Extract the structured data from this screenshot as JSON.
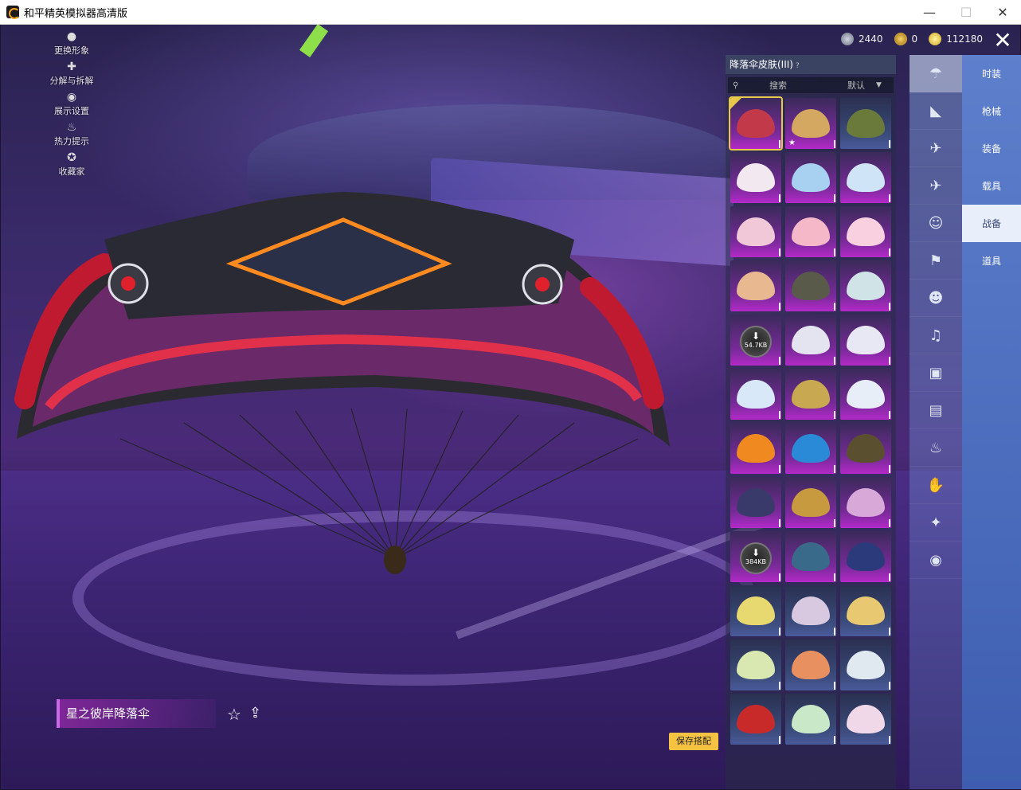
{
  "window": {
    "title": "和平精英模拟器高清版",
    "min": "—",
    "max": "☐",
    "close": "✕"
  },
  "currency": [
    {
      "value": "2440"
    },
    {
      "value": "0"
    },
    {
      "value": "112180"
    }
  ],
  "tools": [
    {
      "label": "更换形象",
      "icon": "person-icon"
    },
    {
      "label": "分解与拆解",
      "icon": "puzzle-icon"
    },
    {
      "label": "展示设置",
      "icon": "eye-icon"
    },
    {
      "label": "热力提示",
      "icon": "flame-icon"
    },
    {
      "label": "收藏家",
      "icon": "collector-icon"
    }
  ],
  "panel": {
    "title": "降落伞皮肤(III)",
    "help": "?",
    "search_label": "搜索",
    "sort_label": "默认"
  },
  "grid": [
    {
      "color": "#c23a4a",
      "style": "purple",
      "selected": true
    },
    {
      "color": "#d4a860",
      "style": "purple",
      "star": "★"
    },
    {
      "color": "#6a7a3a",
      "style": "blue"
    },
    {
      "color": "#f2e8f0",
      "style": "purple"
    },
    {
      "color": "#a8d0f0",
      "style": "purple"
    },
    {
      "color": "#cfe4f6",
      "style": "purple"
    },
    {
      "color": "#f0c8d8",
      "style": "purple"
    },
    {
      "color": "#f4b8c8",
      "style": "purple"
    },
    {
      "color": "#f8d0e0",
      "style": "purple"
    },
    {
      "color": "#e8b890",
      "style": "purple"
    },
    {
      "color": "#5a5a4a",
      "style": "purple"
    },
    {
      "color": "#d0e4e8",
      "style": "purple"
    },
    {
      "color": "#333333",
      "style": "purple",
      "download": "54.7KB"
    },
    {
      "color": "#e4e4f0",
      "style": "purple"
    },
    {
      "color": "#e8e8f4",
      "style": "purple"
    },
    {
      "color": "#d8e8f8",
      "style": "purple"
    },
    {
      "color": "#c8a850",
      "style": "purple"
    },
    {
      "color": "#e8eef8",
      "style": "purple"
    },
    {
      "color": "#f08a20",
      "style": "purple"
    },
    {
      "color": "#2a8ad8",
      "style": "purple"
    },
    {
      "color": "#5a5030",
      "style": "purple"
    },
    {
      "color": "#3a3a6a",
      "style": "purple"
    },
    {
      "color": "#c89a40",
      "style": "purple"
    },
    {
      "color": "#d8a8d8",
      "style": "purple"
    },
    {
      "color": "#333333",
      "style": "purple",
      "download": "384KB"
    },
    {
      "color": "#3a6a8a",
      "style": "purple"
    },
    {
      "color": "#2a3a7a",
      "style": "purple"
    },
    {
      "color": "#e8d870",
      "style": "blue"
    },
    {
      "color": "#d8c8e0",
      "style": "blue"
    },
    {
      "color": "#e8c870",
      "style": "blue"
    },
    {
      "color": "#d8e8b0",
      "style": "blue"
    },
    {
      "color": "#e89060",
      "style": "blue"
    },
    {
      "color": "#e0e8f0",
      "style": "blue"
    },
    {
      "color": "#c82a2a",
      "style": "blue"
    },
    {
      "color": "#c8e8c8",
      "style": "blue"
    },
    {
      "color": "#f0d8e8",
      "style": "blue"
    }
  ],
  "icons": [
    {
      "name": "parachute-icon",
      "glyph": "☂",
      "active": true
    },
    {
      "name": "glider-icon",
      "glyph": "◣"
    },
    {
      "name": "drone-icon",
      "glyph": "✈"
    },
    {
      "name": "plane-icon",
      "glyph": "✈"
    },
    {
      "name": "emote-icon",
      "glyph": "☺"
    },
    {
      "name": "banner-icon",
      "glyph": "⚑"
    },
    {
      "name": "avatar-icon",
      "glyph": "☻"
    },
    {
      "name": "sound-icon",
      "glyph": "♫"
    },
    {
      "name": "box-icon",
      "glyph": "▣"
    },
    {
      "name": "image-icon",
      "glyph": "▤"
    },
    {
      "name": "extinguisher-icon",
      "glyph": "♨"
    },
    {
      "name": "hand-icon",
      "glyph": "✋"
    },
    {
      "name": "wand-icon",
      "glyph": "✦"
    },
    {
      "name": "planet-icon",
      "glyph": "◉"
    }
  ],
  "categories": [
    {
      "label": "时装"
    },
    {
      "label": "枪械"
    },
    {
      "label": "装备"
    },
    {
      "label": "载具"
    },
    {
      "label": "战备",
      "active": true
    },
    {
      "label": "道具"
    }
  ],
  "skin_name": "星之彼岸降落伞",
  "save_button": "保存搭配",
  "close_x": "✕"
}
